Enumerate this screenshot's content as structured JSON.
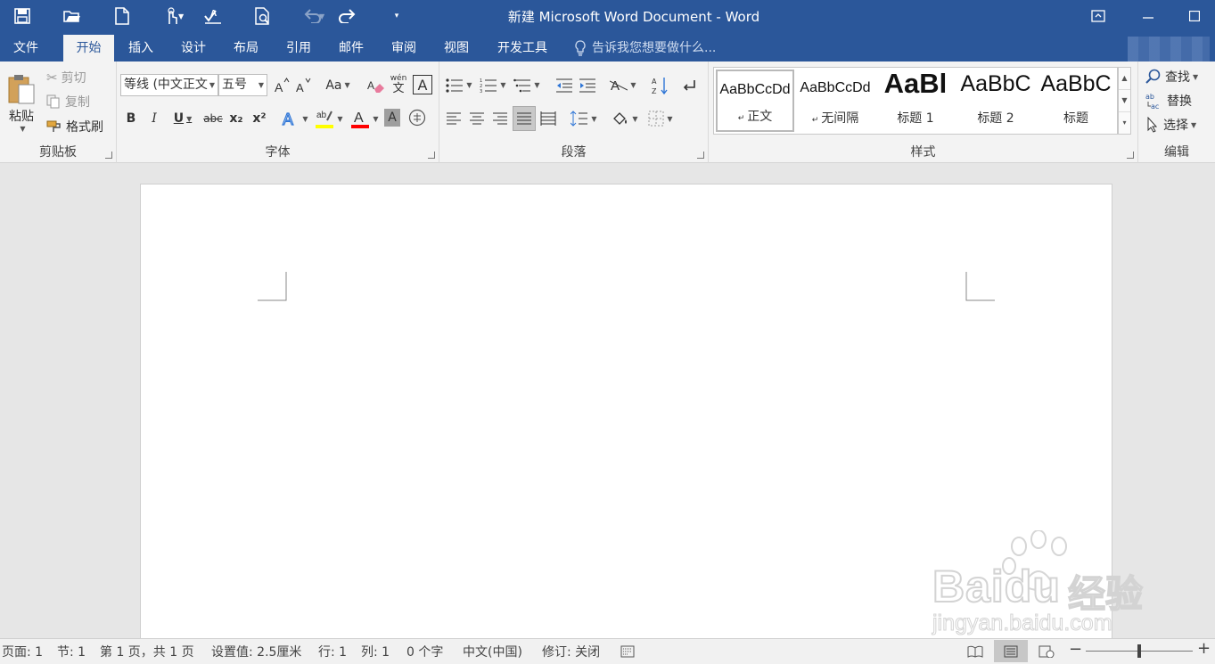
{
  "window": {
    "title": "新建 Microsoft Word Document - Word"
  },
  "tabs": [
    "文件",
    "开始",
    "插入",
    "设计",
    "布局",
    "引用",
    "邮件",
    "审阅",
    "视图",
    "开发工具"
  ],
  "tell_me": "告诉我您想要做什么...",
  "clipboard": {
    "paste": "粘贴",
    "cut": "剪切",
    "copy": "复制",
    "format_painter": "格式刷",
    "label": "剪贴板"
  },
  "font": {
    "name": "等线 (中文正文",
    "size": "五号",
    "case": "Aa",
    "phonetic_top": "wén",
    "phonetic_bottom": "文",
    "boxed": "A",
    "bold": "B",
    "italic": "I",
    "underline": "U",
    "strike": "abc",
    "sub": "x₂",
    "sup": "x²",
    "label": "字体",
    "highlight_color": "#ffff00",
    "font_color": "#ff0000"
  },
  "paragraph": {
    "label": "段落"
  },
  "styles": {
    "label": "样式",
    "items": [
      {
        "preview": "AaBbCcDd",
        "name": "正文"
      },
      {
        "preview": "AaBbCcDd",
        "name": "无间隔"
      },
      {
        "preview": "AaBl",
        "name": "标题 1"
      },
      {
        "preview": "AaBbC",
        "name": "标题 2"
      },
      {
        "preview": "AaBbC",
        "name": "标题"
      }
    ]
  },
  "editing": {
    "find": "查找",
    "replace": "替换",
    "select": "选择",
    "label": "编辑"
  },
  "status": {
    "page": "页面: 1",
    "section": "节: 1",
    "page_of": "第 1 页，共 1 页",
    "setting": "设置值: 2.5厘米",
    "line": "行: 1",
    "column": "列: 1",
    "words": "0 个字",
    "language": "中文(中国)",
    "track": "修订: 关闭"
  },
  "watermark": {
    "brand": "Baidu",
    "brand_cn": "经验",
    "url": "jingyan.baidu.com"
  },
  "colors": {
    "brand_blue": "#2b579a",
    "ribbon_bg": "#f3f3f3"
  }
}
